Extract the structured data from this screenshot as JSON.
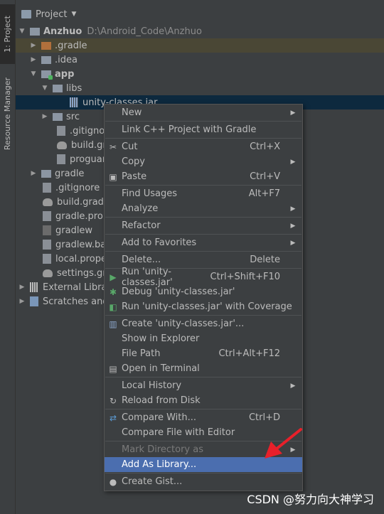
{
  "sidebar": {
    "project_tab": "1: Project",
    "resource_tab": "Resource Manager"
  },
  "header": {
    "title": "Project",
    "dropdown_icon": "chevron-down-icon"
  },
  "tree": [
    {
      "label": "Anzhuo",
      "path": "D:\\Android_Code\\Anzhuo"
    },
    {
      "label": ".gradle"
    },
    {
      "label": ".idea"
    },
    {
      "label": "app"
    },
    {
      "label": "libs"
    },
    {
      "label": "unity-classes.jar"
    },
    {
      "label": "src"
    },
    {
      "label": ".gitignor"
    },
    {
      "label": "build.gra"
    },
    {
      "label": "proguar"
    },
    {
      "label": "gradle"
    },
    {
      "label": ".gitignore"
    },
    {
      "label": "build.gradle"
    },
    {
      "label": "gradle.prop"
    },
    {
      "label": "gradlew"
    },
    {
      "label": "gradlew.bat"
    },
    {
      "label": "local.prope"
    },
    {
      "label": "settings.gra"
    },
    {
      "label": "External Librar"
    },
    {
      "label": "Scratches and"
    }
  ],
  "context_menu": {
    "items": [
      {
        "label": "New",
        "shortcut": "",
        "sub": "▶"
      },
      {
        "label": "Link C++ Project with Gradle",
        "shortcut": "",
        "sub": ""
      },
      {
        "label": "Cut",
        "shortcut": "Ctrl+X",
        "sub": ""
      },
      {
        "label": "Copy",
        "shortcut": "",
        "sub": "▶"
      },
      {
        "label": "Paste",
        "shortcut": "Ctrl+V",
        "sub": ""
      },
      {
        "label": "Find Usages",
        "shortcut": "Alt+F7",
        "sub": ""
      },
      {
        "label": "Analyze",
        "shortcut": "",
        "sub": "▶"
      },
      {
        "label": "Refactor",
        "shortcut": "",
        "sub": "▶"
      },
      {
        "label": "Add to Favorites",
        "shortcut": "",
        "sub": "▶"
      },
      {
        "label": "Delete...",
        "shortcut": "Delete",
        "sub": ""
      },
      {
        "label": "Run 'unity-classes.jar'",
        "shortcut": "Ctrl+Shift+F10",
        "sub": ""
      },
      {
        "label": "Debug 'unity-classes.jar'",
        "shortcut": "",
        "sub": ""
      },
      {
        "label": "Run 'unity-classes.jar' with Coverage",
        "shortcut": "",
        "sub": ""
      },
      {
        "label": "Create 'unity-classes.jar'...",
        "shortcut": "",
        "sub": ""
      },
      {
        "label": "Show in Explorer",
        "shortcut": "",
        "sub": ""
      },
      {
        "label": "File Path",
        "shortcut": "Ctrl+Alt+F12",
        "sub": ""
      },
      {
        "label": "Open in Terminal",
        "shortcut": "",
        "sub": ""
      },
      {
        "label": "Local History",
        "shortcut": "",
        "sub": "▶"
      },
      {
        "label": "Reload from Disk",
        "shortcut": "",
        "sub": ""
      },
      {
        "label": "Compare With...",
        "shortcut": "Ctrl+D",
        "sub": ""
      },
      {
        "label": "Compare File with Editor",
        "shortcut": "",
        "sub": ""
      },
      {
        "label": "Mark Directory as",
        "shortcut": "",
        "sub": "▶"
      },
      {
        "label": "Add As Library...",
        "shortcut": "",
        "sub": ""
      },
      {
        "label": "Create Gist...",
        "shortcut": "",
        "sub": ""
      }
    ]
  },
  "watermark": "CSDN @努力向大神学习",
  "colors": {
    "accent": "#4b6eaf",
    "selection": "#0d293e",
    "highlight": "#4a4735",
    "annotation_arrow": "#e8202a"
  }
}
